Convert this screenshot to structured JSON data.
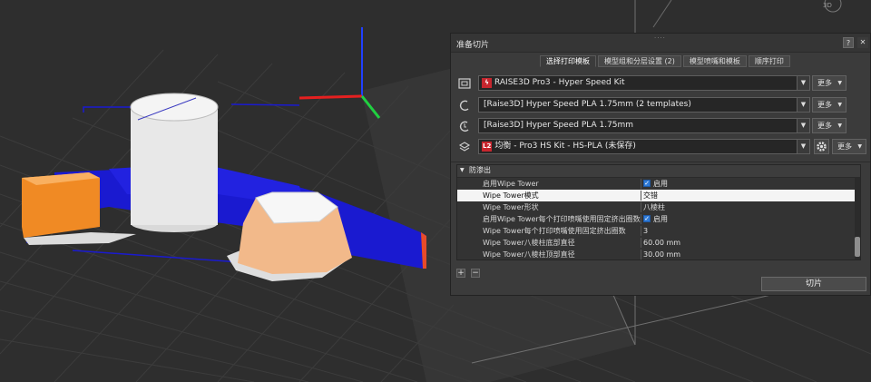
{
  "dialog": {
    "title": "准备切片",
    "help_label": "?",
    "close_label": "✕",
    "tabs": [
      {
        "label": "选择打印模板",
        "active": true
      },
      {
        "label": "模型组和分层设置 (2)",
        "active": false
      },
      {
        "label": "模型喷嘴和模板",
        "active": false
      },
      {
        "label": "顺序打印",
        "active": false
      }
    ],
    "printer": {
      "badge": "",
      "value": "RAISE3D Pro3 - Hyper Speed Kit",
      "more": "更多"
    },
    "filament_left": {
      "value": "[Raise3D] Hyper Speed PLA 1.75mm (2 templates)",
      "more": "更多"
    },
    "filament_right": {
      "value": "[Raise3D] Hyper Speed PLA 1.75mm",
      "more": "更多"
    },
    "template": {
      "badge": "L2",
      "value": "均衡 - Pro3 HS Kit - HS-PLA (未保存)",
      "more": "更多"
    },
    "settings": {
      "section": "防渗出",
      "rows": [
        {
          "label": "启用Wipe Tower",
          "value": "启用",
          "checkbox": true,
          "selected": false
        },
        {
          "label": "Wipe Tower模式",
          "value": "交错",
          "checkbox": false,
          "selected": true
        },
        {
          "label": "Wipe Tower形状",
          "value": "八棱柱",
          "checkbox": false,
          "selected": false
        },
        {
          "label": "启用Wipe Tower每个打印喷嘴使用固定挤出圈数",
          "value": "启用",
          "checkbox": true,
          "selected": false
        },
        {
          "label": "Wipe Tower每个打印喷嘴使用固定挤出圈数",
          "value": "3",
          "checkbox": false,
          "selected": false
        },
        {
          "label": "Wipe Tower八棱柱底部直径",
          "value": "60.00 mm",
          "checkbox": false,
          "selected": false
        },
        {
          "label": "Wipe Tower八棱柱顶部直径",
          "value": "30.00 mm",
          "checkbox": false,
          "selected": false
        }
      ]
    },
    "add_label": "+",
    "remove_label": "−",
    "slice_label": "切片"
  },
  "colors": {
    "viewport_bg": "#2e2e2e",
    "model_orange": "#f08a24",
    "model_white": "#e6e6e6",
    "wipe_blue": "#1a1ad0",
    "axis_red": "#e52020",
    "axis_green": "#20d040",
    "axis_blue": "#2040ff"
  },
  "icons": {
    "printer": "printer-icon",
    "nozzle_left": "nozzle-left-icon",
    "nozzle_right": "nozzle-right-icon",
    "layers": "layers-icon",
    "gear": "gear-icon",
    "view_cube": "view-cube-icon"
  }
}
